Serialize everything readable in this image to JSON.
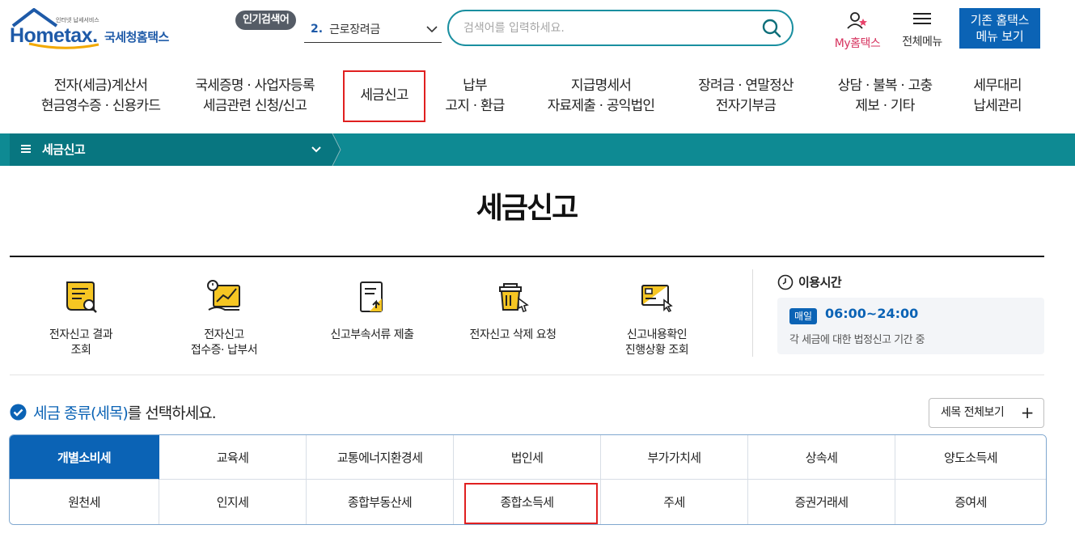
{
  "header": {
    "logo_tagline": "인터넷 납세서비스",
    "logo_brand": "Hometax.",
    "logo_korean": "국세청홈택스",
    "popular_badge": "인기검색어",
    "popular_rank": "2.",
    "popular_keyword": "근로장려금",
    "search_placeholder": "검색어를 입력하세요.",
    "my_label": "My홈택스",
    "all_menu_label": "전체메뉴",
    "classic_line1": "기존 홈택스",
    "classic_line2": "메뉴 보기"
  },
  "gnb": [
    {
      "line1": "전자(세금)계산서",
      "line2": "현금영수증 · 신용카드"
    },
    {
      "line1": "국세증명 · 사업자등록",
      "line2": "세금관련 신청/신고"
    },
    {
      "line1": "세금신고",
      "line2": ""
    },
    {
      "line1": "납부",
      "line2": "고지 · 환급"
    },
    {
      "line1": "지급명세서",
      "line2": "자료제출 · 공익법인"
    },
    {
      "line1": "장려금 · 연말정산",
      "line2": "전자기부금"
    },
    {
      "line1": "상담 · 불복 · 고충",
      "line2": "제보 · 기타"
    },
    {
      "line1": "세무대리",
      "line2": "납세관리"
    }
  ],
  "subbar": {
    "title": "세금신고"
  },
  "page_title": "세금신고",
  "services": [
    {
      "line1": "전자신고 결과",
      "line2": "조회",
      "icon": "result-search-icon"
    },
    {
      "line1": "전자신고",
      "line2": "접수증· 납부서",
      "icon": "receipt-chart-icon"
    },
    {
      "line1": "신고부속서류 제출",
      "line2": "",
      "icon": "document-upload-icon"
    },
    {
      "line1": "전자신고 삭제 요청",
      "line2": "",
      "icon": "trash-click-icon"
    },
    {
      "line1": "신고내용확인",
      "line2": "진행상황 조회",
      "icon": "progress-check-icon"
    }
  ],
  "usage": {
    "title": "이용시간",
    "badge": "매일",
    "hours": "06:00~24:00",
    "note": "각 세금에 대한 법정신고 기간 중"
  },
  "tax_section": {
    "heading_accent": "세금 종류(세목)",
    "heading_rest": "를 선택하세요.",
    "view_all_label": "세목 전체보기",
    "view_all_plus": "+"
  },
  "tax_types": [
    [
      "개별소비세",
      "교육세",
      "교통에너지환경세",
      "법인세",
      "부가가치세",
      "상속세",
      "양도소득세"
    ],
    [
      "원천세",
      "인지세",
      "종합부동산세",
      "종합소득세",
      "주세",
      "증권거래세",
      "증여세"
    ]
  ],
  "colors": {
    "brand_blue": "#0b63b5",
    "teal": "#0e8a93",
    "highlight_red": "#e02020",
    "my_pink": "#d6335f"
  }
}
